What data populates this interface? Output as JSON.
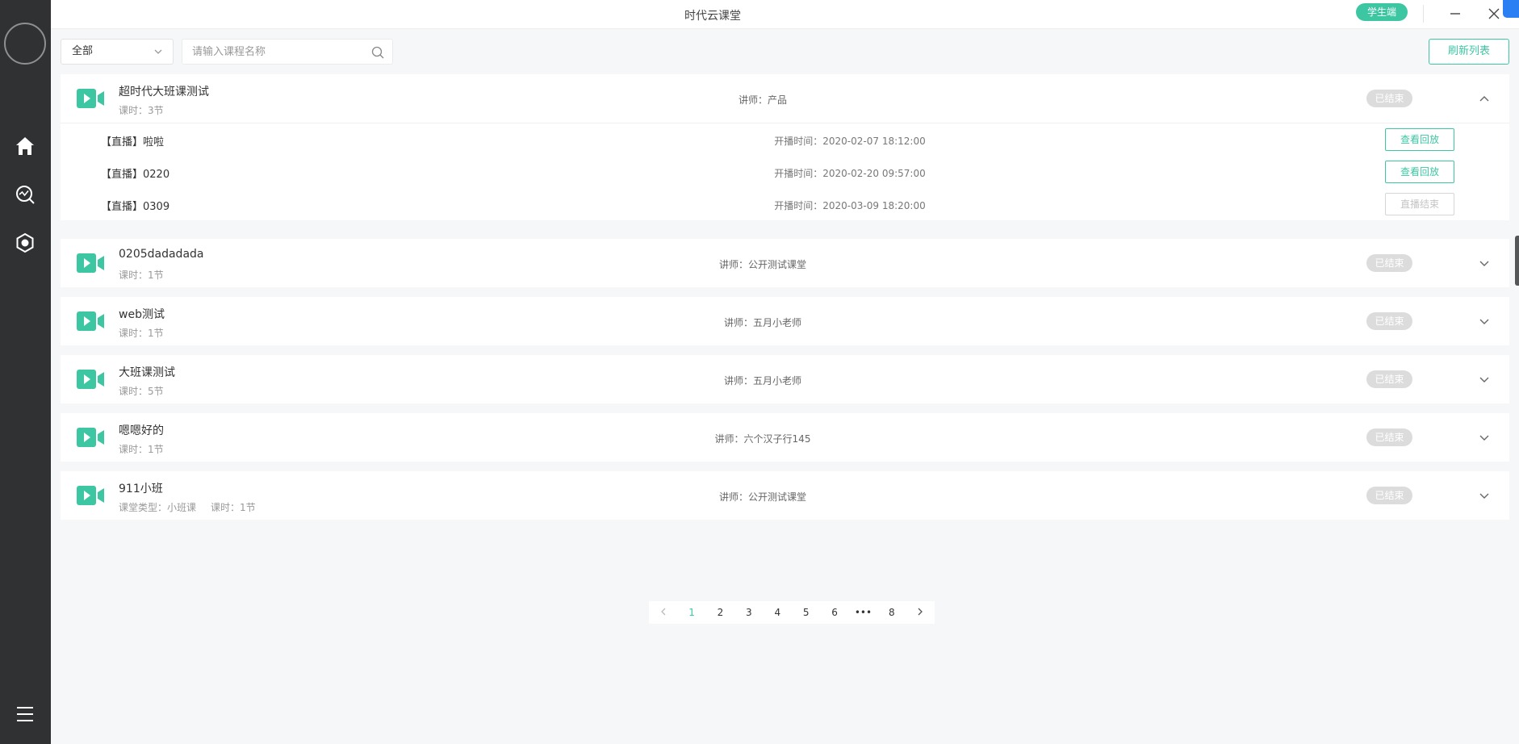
{
  "window": {
    "title": "时代云课堂",
    "role_badge": "学生端"
  },
  "toolbar": {
    "filter_value": "全部",
    "search_placeholder": "请输入课程名称",
    "search_value": "",
    "refresh_label": "刷新列表"
  },
  "courses": [
    {
      "title": "超时代大班课测试",
      "meta": [
        "课时：3节"
      ],
      "teacher": "讲师：产品",
      "status": "已结束",
      "expanded": true,
      "lessons": [
        {
          "title": "【直播】啦啦",
          "time": "开播时间：2020-02-07 18:12:00",
          "action": "查看回放",
          "enabled": true
        },
        {
          "title": "【直播】0220",
          "time": "开播时间：2020-02-20 09:57:00",
          "action": "查看回放",
          "enabled": true
        },
        {
          "title": "【直播】0309",
          "time": "开播时间：2020-03-09 18:20:00",
          "action": "直播结束",
          "enabled": false
        }
      ]
    },
    {
      "title": "0205dadadada",
      "meta": [
        "课时：1节"
      ],
      "teacher": "讲师：公开测试课堂",
      "status": "已结束",
      "expanded": false
    },
    {
      "title": "web测试",
      "meta": [
        "课时：1节"
      ],
      "teacher": "讲师：五月小老师",
      "status": "已结束",
      "expanded": false
    },
    {
      "title": "大班课测试",
      "meta": [
        "课时：5节"
      ],
      "teacher": "讲师：五月小老师",
      "status": "已结束",
      "expanded": false
    },
    {
      "title": "嗯嗯好的",
      "meta": [
        "课时：1节"
      ],
      "teacher": "讲师：六个汉子行145",
      "status": "已结束",
      "expanded": false
    },
    {
      "title": "911小班",
      "meta": [
        "课堂类型：小班课",
        "课时：1节"
      ],
      "teacher": "讲师：公开测试课堂",
      "status": "已结束",
      "expanded": false
    }
  ],
  "pagination": {
    "pages": [
      "1",
      "2",
      "3",
      "4",
      "5",
      "6",
      "•••",
      "8"
    ],
    "current": "1"
  },
  "colors": {
    "accent": "#3cc7a2",
    "sidebar": "#2f3133",
    "status_pill": "#dcdcdc"
  },
  "icons": {
    "sidebar": [
      "home-icon",
      "search-chart-icon",
      "settings-hex-icon",
      "menu-icon"
    ],
    "course": "video-camera-icon"
  }
}
